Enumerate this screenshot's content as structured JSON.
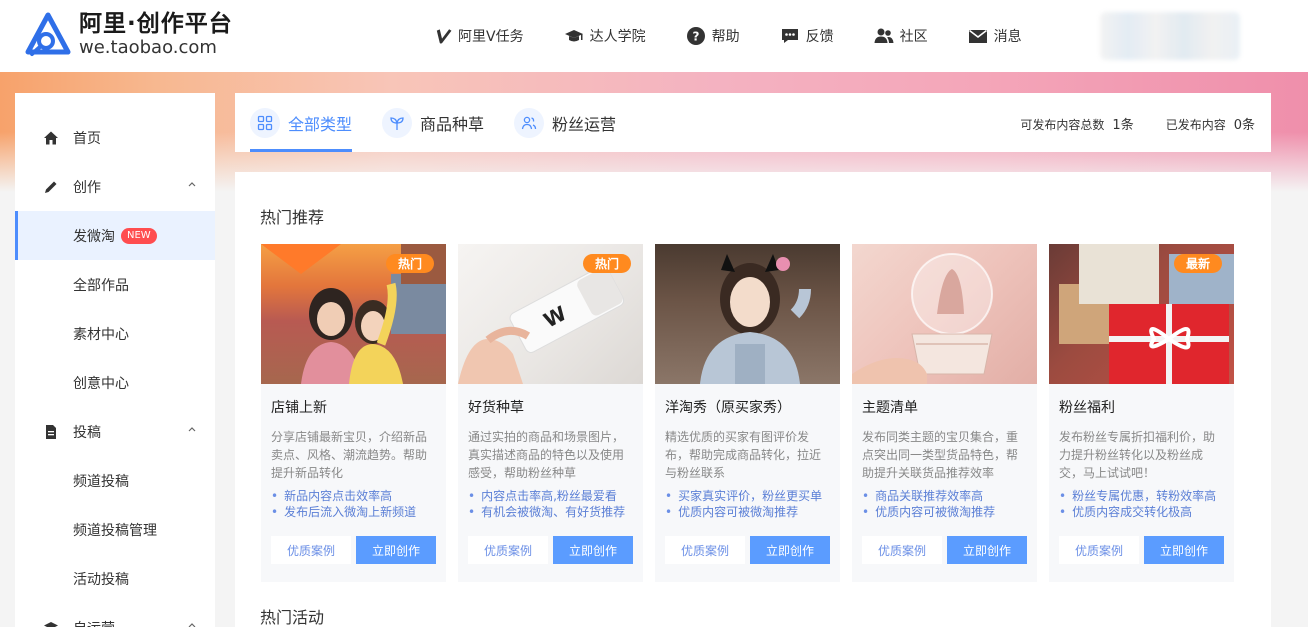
{
  "header": {
    "logo_title": "阿里·创作平台",
    "logo_sub": "we.taobao.com",
    "nav": [
      {
        "label": "阿里V任务",
        "icon": "v-icon"
      },
      {
        "label": "达人学院",
        "icon": "graduation-cap-icon"
      },
      {
        "label": "帮助",
        "icon": "help-icon"
      },
      {
        "label": "反馈",
        "icon": "feedback-icon"
      },
      {
        "label": "社区",
        "icon": "community-icon"
      },
      {
        "label": "消息",
        "icon": "mail-icon"
      }
    ]
  },
  "sidebar": {
    "items": [
      {
        "label": "首页",
        "icon": "home-icon"
      },
      {
        "label": "创作",
        "icon": "pen-icon"
      },
      {
        "label": "发微淘",
        "badge": "NEW"
      },
      {
        "label": "全部作品"
      },
      {
        "label": "素材中心"
      },
      {
        "label": "创意中心"
      },
      {
        "label": "投稿",
        "icon": "document-icon"
      },
      {
        "label": "频道投稿"
      },
      {
        "label": "频道投稿管理"
      },
      {
        "label": "活动投稿"
      },
      {
        "label": "自运营",
        "icon": "layers-icon"
      }
    ]
  },
  "tabs": [
    {
      "label": "全部类型",
      "icon": "grid-icon"
    },
    {
      "label": "商品种草",
      "icon": "sprout-icon"
    },
    {
      "label": "粉丝运营",
      "icon": "users-icon"
    }
  ],
  "stats": {
    "total_label": "可发布内容总数",
    "total_value": "1条",
    "published_label": "已发布内容",
    "published_value": "0条"
  },
  "sections": {
    "hot_recommend": "热门推荐",
    "hot_activity": "热门活动"
  },
  "cards": [
    {
      "title": "店铺上新",
      "tag": "热门",
      "desc": "分享店铺最新宝贝，介绍新品卖点、风格、潮流趋势。帮助提升新品转化",
      "points": [
        "新品内容点击效率高",
        "发布后流入微淘上新频道"
      ],
      "btn_case": "优质案例",
      "btn_create": "立即创作"
    },
    {
      "title": "好货种草",
      "tag": "热门",
      "desc": "通过实拍的商品和场景图片，真实描述商品的特色以及使用感受，帮助粉丝种草",
      "points": [
        "内容点击率高,粉丝最爱看",
        "有机会被微淘、有好货推荐"
      ],
      "btn_case": "优质案例",
      "btn_create": "立即创作"
    },
    {
      "title": "洋淘秀（原买家秀）",
      "tag": "",
      "desc": "精选优质的买家有图评价发布，帮助完成商品转化，拉近与粉丝联系",
      "points": [
        "买家真实评价，粉丝更买单",
        "优质内容可被微淘推荐"
      ],
      "btn_case": "优质案例",
      "btn_create": "立即创作"
    },
    {
      "title": "主题清单",
      "tag": "",
      "desc": "发布同类主题的宝贝集合，重点突出同一类型货品特色，帮助提升关联货品推荐效率",
      "points": [
        "商品关联推荐效率高",
        "优质内容可被微淘推荐"
      ],
      "btn_case": "优质案例",
      "btn_create": "立即创作"
    },
    {
      "title": "粉丝福利",
      "tag": "最新",
      "desc": "发布粉丝专属折扣福利价，助力提升粉丝转化以及粉丝成交，马上试试吧！",
      "points": [
        "粉丝专属优惠，转粉效率高",
        "优质内容成交转化极高"
      ],
      "btn_case": "优质案例",
      "btn_create": "立即创作"
    }
  ]
}
